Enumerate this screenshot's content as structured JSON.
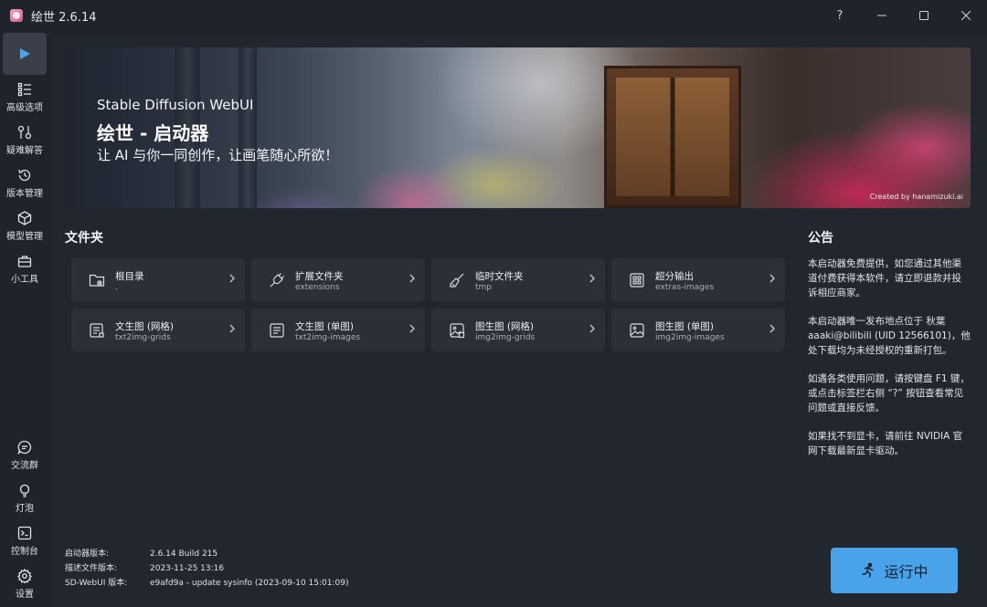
{
  "window": {
    "title": "绘世 2.6.14",
    "controls": [
      "?",
      "minimize",
      "maximize",
      "close"
    ]
  },
  "sidebar": {
    "items": [
      {
        "label": "",
        "icon": "play-icon",
        "active": true
      },
      {
        "label": "高级选项",
        "icon": "list-settings-icon"
      },
      {
        "label": "疑难解答",
        "icon": "wrench-icon"
      },
      {
        "label": "版本管理",
        "icon": "history-icon"
      },
      {
        "label": "模型管理",
        "icon": "cube-icon"
      },
      {
        "label": "小工具",
        "icon": "toolbox-icon"
      },
      {
        "label": "交流群",
        "icon": "chat-icon"
      },
      {
        "label": "灯泡",
        "icon": "lightbulb-icon"
      },
      {
        "label": "控制台",
        "icon": "console-icon"
      },
      {
        "label": "设置",
        "icon": "gear-icon"
      }
    ]
  },
  "banner": {
    "subtitle": "Stable Diffusion WebUI",
    "title": "绘世 - 启动器",
    "slogan": "让 AI 与你一同创作，让画笔随心所欲！",
    "credit": "Created by hanamizuki.ai"
  },
  "folders": {
    "title": "文件夹",
    "items": [
      {
        "name": "根目录",
        "path": ".",
        "icon": "folder-icon"
      },
      {
        "name": "扩展文件夹",
        "path": "extensions",
        "icon": "plug-icon"
      },
      {
        "name": "临时文件夹",
        "path": "tmp",
        "icon": "broom-icon"
      },
      {
        "name": "超分输出",
        "path": "extras-images",
        "icon": "grid-icon"
      },
      {
        "name": "文生图 (网格)",
        "path": "txt2img-grids",
        "icon": "text-doc-grid-icon"
      },
      {
        "name": "文生图 (单图)",
        "path": "txt2img-images",
        "icon": "text-doc-icon"
      },
      {
        "name": "图生图 (网格)",
        "path": "img2img-grids",
        "icon": "image-grid-icon"
      },
      {
        "name": "图生图 (单图)",
        "path": "img2img-images",
        "icon": "image-icon"
      }
    ]
  },
  "notice": {
    "title": "公告",
    "paragraphs": [
      "本启动器免费提供，如您通过其他渠道付费获得本软件，请立即退款并投诉相应商家。",
      "本启动器唯一发布地点位于 秋葉aaaki@bilibili (UID 12566101)，他处下载均为未经授权的重新打包。",
      "如遇各类使用问题，请按键盘 F1 键，或点击标签栏右侧 “?” 按钮查看常见问题或直接反馈。",
      "如果找不到显卡，请前往 NVIDIA 官网下载最新显卡驱动。"
    ]
  },
  "version_info": {
    "rows": [
      {
        "key": "启动器版本:",
        "value": "2.6.14 Build 215"
      },
      {
        "key": "描述文件版本:",
        "value": "2023-11-25 13:16"
      },
      {
        "key": "SD-WebUI 版本:",
        "value": "e9afd9a - update sysinfo (2023-09-10 15:01:09)"
      }
    ]
  },
  "run_button": {
    "label": "运行中",
    "color": "#4aa3e8"
  },
  "colors": {
    "background": "#1f232b",
    "panel": "#22262e",
    "card": "#2b3038",
    "accent": "#4aa3e8"
  }
}
